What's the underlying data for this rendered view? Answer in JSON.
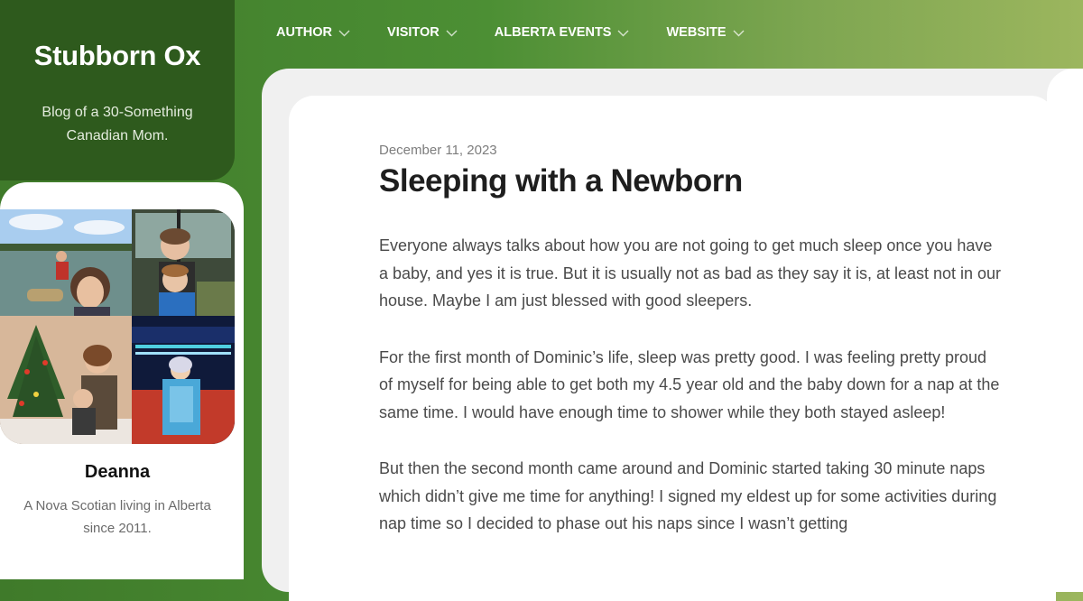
{
  "site": {
    "title": "Stubborn Ox",
    "tagline": "Blog of a 30-Something Canadian Mom."
  },
  "nav": [
    {
      "label": "AUTHOR"
    },
    {
      "label": "VISITOR"
    },
    {
      "label": "ALBERTA EVENTS"
    },
    {
      "label": "WEBSITE"
    }
  ],
  "sidebar": {
    "name": "Deanna",
    "bio": "A Nova Scotian living in Alberta since 2011."
  },
  "post": {
    "date": "December 11, 2023",
    "title": "Sleeping with a Newborn",
    "paragraphs": [
      "Everyone always talks about how you are not going to get much sleep once you have a baby, and yes it is true. But it is usually not as bad as they say it is, at least not in our house. Maybe I am just blessed with good sleepers.",
      "For the first month of Dominic’s life, sleep was pretty good. I was feeling pretty proud of myself for being able to get both my 4.5 year old and the baby down for a nap at the same time. I would have enough time to shower while they both stayed asleep!",
      "But then the second month came around and Dominic started taking 30 minute naps which didn’t give me time for anything! I signed my eldest up for some activities during nap time so I decided to phase out his naps since I wasn’t getting"
    ]
  },
  "colors": {
    "header_gradient_start": "#3f7a2a",
    "header_gradient_end": "#9cb65e",
    "brand_bg": "#2e5a1d",
    "title_text": "#1e1e1e",
    "body_text": "#4a4a4a"
  }
}
